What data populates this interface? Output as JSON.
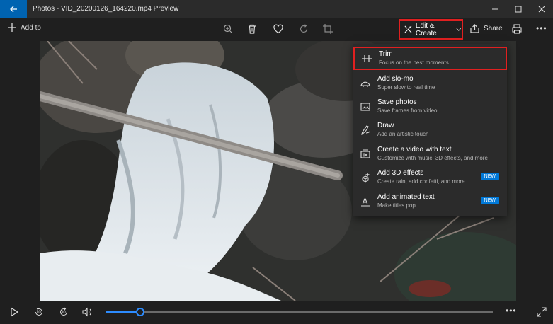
{
  "window": {
    "title": "Photos - VID_20200126_164220.mp4 Preview",
    "accent": "#0063b1"
  },
  "toolbar": {
    "add_to_label": "Add to",
    "icons": [
      "zoom-in-icon",
      "delete-icon",
      "heart-icon",
      "rotate-icon",
      "crop-icon"
    ],
    "edit_create_label": "Edit & Create",
    "share_label": "Share",
    "highlight_color": "#e02020"
  },
  "menu": {
    "items": [
      {
        "label": "Trim",
        "sub": "Focus on the best moments",
        "icon": "trim-icon",
        "badge": ""
      },
      {
        "label": "Add slo-mo",
        "sub": "Super slow to real time",
        "icon": "slomo-icon",
        "badge": ""
      },
      {
        "label": "Save photos",
        "sub": "Save frames from video",
        "icon": "save-photos-icon",
        "badge": ""
      },
      {
        "label": "Draw",
        "sub": "Add an artistic touch",
        "icon": "draw-icon",
        "badge": ""
      },
      {
        "label": "Create a video with text",
        "sub": "Customize with music, 3D effects, and more",
        "icon": "video-text-icon",
        "badge": ""
      },
      {
        "label": "Add 3D effects",
        "sub": "Create rain, add confetti, and more",
        "icon": "3d-effects-icon",
        "badge": "NEW"
      },
      {
        "label": "Add animated text",
        "sub": "Make titles pop",
        "icon": "animated-text-icon",
        "badge": "NEW"
      }
    ]
  },
  "playback": {
    "skip_back_label": "10",
    "skip_forward_label": "30",
    "progress_fraction": 0.09,
    "accent": "#2d8cff"
  }
}
